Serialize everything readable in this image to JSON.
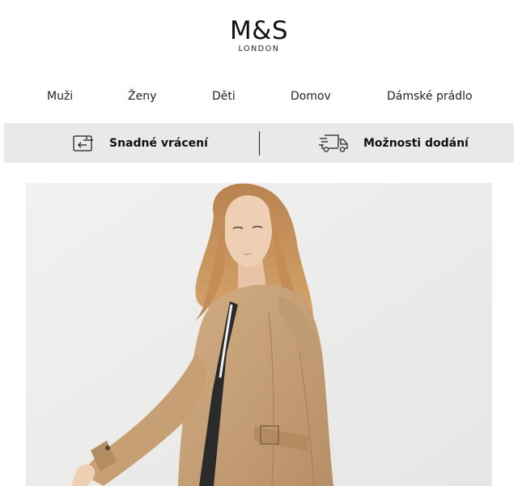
{
  "brand": {
    "name": "M&S",
    "subtitle": "LONDON"
  },
  "nav": {
    "items": [
      {
        "label": "Muži"
      },
      {
        "label": "Ženy"
      },
      {
        "label": "Děti"
      },
      {
        "label": "Domov"
      },
      {
        "label": "Dámské prádlo"
      }
    ]
  },
  "service_bar": {
    "returns": {
      "label": "Snadné vrácení",
      "icon": "returns-icon"
    },
    "delivery": {
      "label": "Možnosti dodání",
      "icon": "delivery-truck-icon"
    }
  },
  "hero": {
    "image": "woman-in-beige-trench-coat"
  },
  "colors": {
    "text": "#1a1a1a",
    "service_bar_bg": "#e9e9e9",
    "hero_bg": "#ededed",
    "coat": "#c9a47c",
    "hair": "#c8935a"
  }
}
